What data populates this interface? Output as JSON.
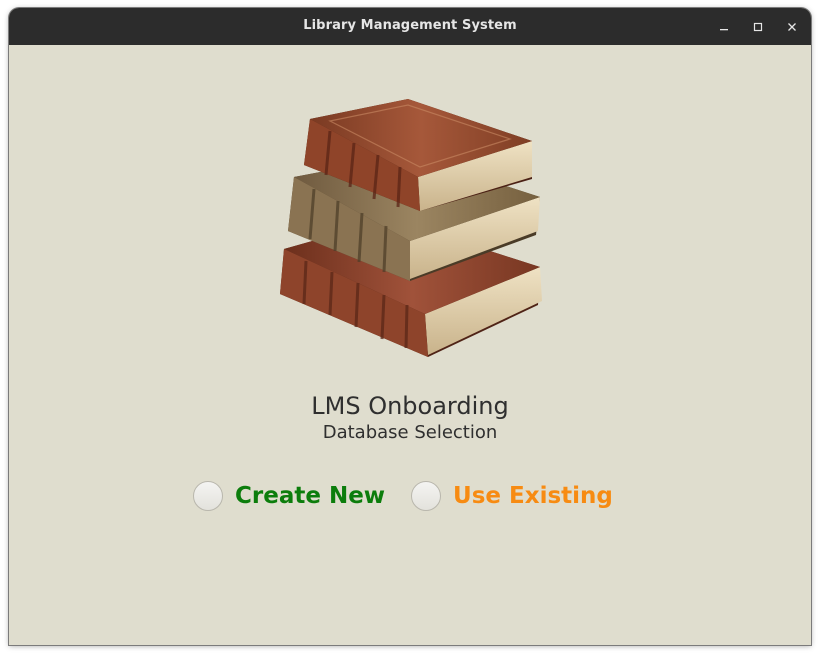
{
  "window": {
    "title": "Library Management System",
    "controls": {
      "minimize_icon": "minimize-icon",
      "maximize_icon": "maximize-icon",
      "close_icon": "close-icon"
    }
  },
  "main": {
    "illustration": "stacked-books-image",
    "heading": "LMS Onboarding",
    "subheading": "Database Selection",
    "options": [
      {
        "label": "Create New",
        "color": "#0c7d0c",
        "selected": false
      },
      {
        "label": "Use Existing",
        "color": "#f78b12",
        "selected": false
      }
    ]
  },
  "colors": {
    "background": "#dfddce",
    "titlebar": "#2c2c2c"
  }
}
